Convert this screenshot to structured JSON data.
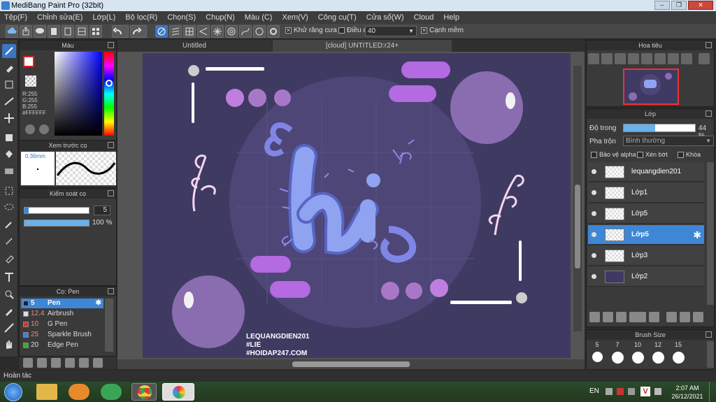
{
  "window": {
    "title": "MediBang Paint Pro (32bit)"
  },
  "menu": [
    "Tệp(F)",
    "Chỉnh sửa(E)",
    "Lớp(L)",
    "Bộ lọc(R)",
    "Chọn(S)",
    "Chụp(N)",
    "Màu (C)",
    "Xem(V)",
    "Công cụ(T)",
    "Cửa sổ(W)",
    "Cloud",
    "Help"
  ],
  "toolbar": {
    "antialias_label": "Khử răng cưa",
    "adjust_label": "Điều chỉnh",
    "adjust_value": "40",
    "soft_edge_label": "Cạnh mềm"
  },
  "color_panel": {
    "title": "Màu",
    "r": "R:255",
    "g": "G:255",
    "b": "B:255",
    "hex": "#FFFFFF"
  },
  "brush_preview": {
    "title": "Xem trước cọ",
    "size": "0.36mm"
  },
  "brush_control": {
    "title": "Kiểm soát cọ",
    "size_value": "5",
    "opacity_value": "100 %"
  },
  "brush_list": {
    "title": "Cọ: Pen",
    "items": [
      {
        "size": "5",
        "name": "Pen",
        "color": "#222222"
      },
      {
        "size": "12.4",
        "name": "Airbrush",
        "color": "#dddddd"
      },
      {
        "size": "10",
        "name": "G Pen",
        "color": "#e03030"
      },
      {
        "size": "25",
        "name": "Sparkle Brush",
        "color": "#4a7be0"
      },
      {
        "size": "20",
        "name": "Edge Pen",
        "color": "#2cb52c"
      }
    ]
  },
  "tabs": {
    "tab1": "Untitled",
    "tab2": "[cloud] UNTITLED:r24+"
  },
  "artwork": {
    "signature_line1": "LEQUANGDIEN201",
    "signature_line2": "#LIE",
    "signature_line3": "#HOIDAP247.COM",
    "colors": {
      "background": "#3f3a62",
      "circle": "#4e4677",
      "lettering": "#8fa3f0",
      "accent": "#b46ae0"
    }
  },
  "navigator": {
    "title": "Hoa tiêu"
  },
  "layer_panel": {
    "title": "Lớp",
    "opacity_label": "Độ trong",
    "opacity_value": "44 %",
    "opacity_fraction": 0.44,
    "blend_label": "Pha trộn",
    "blend_value": "Bình thường",
    "protect_alpha": "Bảo vệ alpha",
    "clipping": "Xén bớt",
    "lock": "Khóa",
    "layers": [
      {
        "name": "lequangdien201",
        "selected": false
      },
      {
        "name": "Lớp1",
        "selected": false
      },
      {
        "name": "Lớp5",
        "selected": false
      },
      {
        "name": "Lớp5",
        "selected": true
      },
      {
        "name": "Lớp3",
        "selected": false
      },
      {
        "name": "Lớp2",
        "selected": false
      }
    ]
  },
  "brush_size": {
    "title": "Brush Size",
    "sizes": [
      "5",
      "7",
      "10",
      "12",
      "15"
    ]
  },
  "status": {
    "text": "Hoàn tác"
  },
  "taskbar": {
    "lang": "EN",
    "time": "2:07 AM",
    "date": "26/12/2021"
  }
}
